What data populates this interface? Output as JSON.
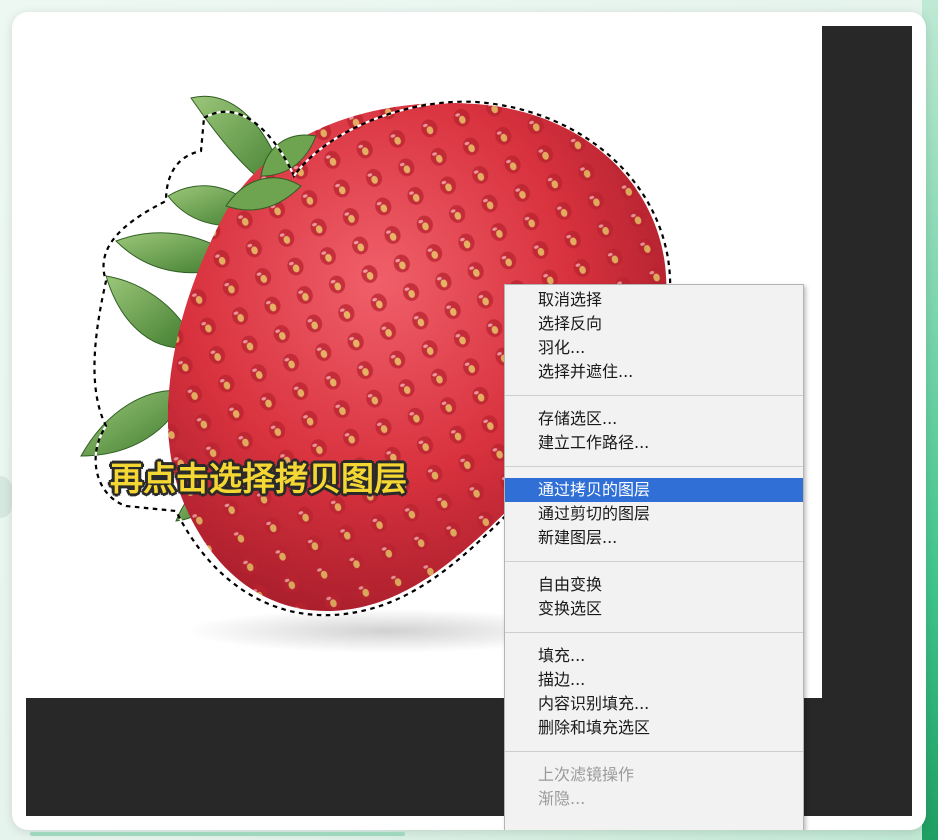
{
  "caption": "再点击选择拷贝图层",
  "context_menu": {
    "groups": [
      {
        "items": [
          {
            "label": "取消选择"
          },
          {
            "label": "选择反向"
          },
          {
            "label": "羽化..."
          },
          {
            "label": "选择并遮住..."
          }
        ]
      },
      {
        "items": [
          {
            "label": "存储选区..."
          },
          {
            "label": "建立工作路径..."
          }
        ]
      },
      {
        "items": [
          {
            "label": "通过拷贝的图层",
            "state": "highlighted"
          },
          {
            "label": "通过剪切的图层"
          },
          {
            "label": "新建图层..."
          }
        ]
      },
      {
        "items": [
          {
            "label": "自由变换"
          },
          {
            "label": "变换选区"
          }
        ]
      },
      {
        "items": [
          {
            "label": "填充..."
          },
          {
            "label": "描边..."
          },
          {
            "label": "内容识别填充..."
          },
          {
            "label": "删除和填充选区"
          }
        ]
      },
      {
        "items": [
          {
            "label": "上次滤镜操作",
            "state": "disabled"
          },
          {
            "label": "渐隐...",
            "state": "disabled"
          }
        ]
      }
    ]
  },
  "colors": {
    "highlight": "#2f6fd6",
    "workspace": "#282828",
    "caption_fill": "#f4d733",
    "strawberry_red": "#d8323e",
    "leaf_green": "#5f9a45"
  },
  "icons": [
    "marching-ants-selection"
  ]
}
